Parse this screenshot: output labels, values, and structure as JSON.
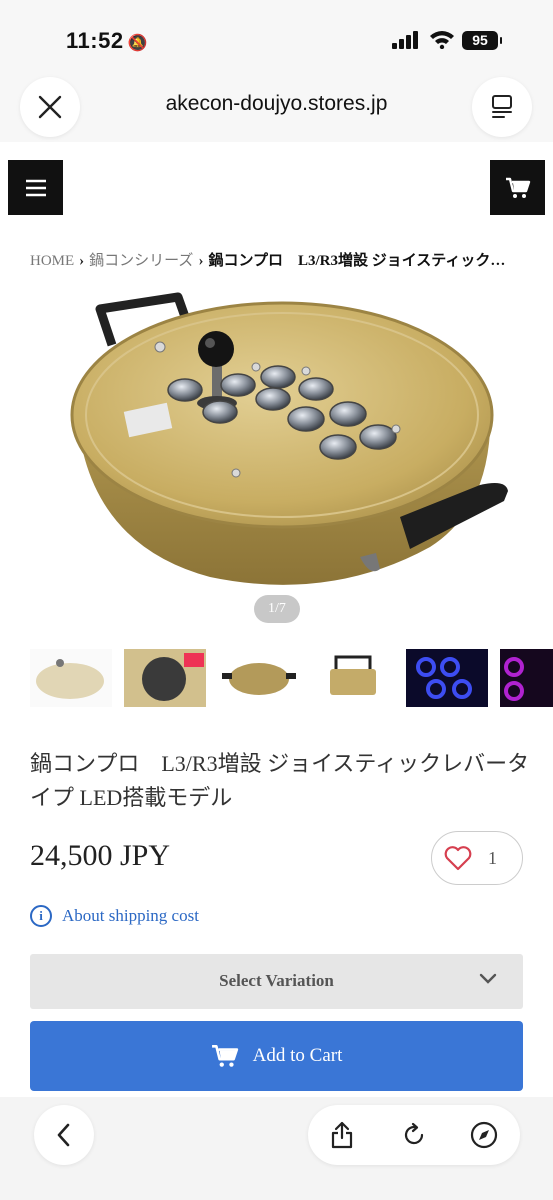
{
  "status": {
    "time": "11:52",
    "battery": "95",
    "icons": [
      "bell-slash-icon",
      "signal-icon",
      "wifi-icon",
      "battery-icon"
    ]
  },
  "browser": {
    "url": "akecon-doujyo.stores.jp",
    "icons": [
      "close-icon",
      "reader-icon",
      "back-icon",
      "share-icon",
      "reload-icon",
      "compass-icon"
    ]
  },
  "header": {
    "icons": [
      "menu-icon",
      "cart-icon"
    ]
  },
  "breadcrumb": {
    "items": [
      "HOME",
      "鍋コンシリーズ"
    ],
    "current": "鍋コンプロ　L3/R3増設 ジョイスティック…"
  },
  "gallery": {
    "pager": "1/7",
    "thumbnails": [
      "pot-controller-photo",
      "pot-controller-box-photo",
      "pot-with-handles-photo",
      "pot-side-view-photo",
      "blue-led-buttons-photo",
      "purple-led-buttons-photo"
    ]
  },
  "product": {
    "title": "鍋コンプロ　L3/R3増設 ジョイスティックレバータイプ LED搭載モデル",
    "price": "24,500 JPY",
    "likes": "1",
    "shipping_link": "About shipping cost",
    "variation_placeholder": "Select Variation",
    "add_to_cart": "Add to Cart"
  },
  "colors": {
    "accent": "#3a76d6",
    "link": "#2b68c4",
    "like": "#d63f4f"
  }
}
